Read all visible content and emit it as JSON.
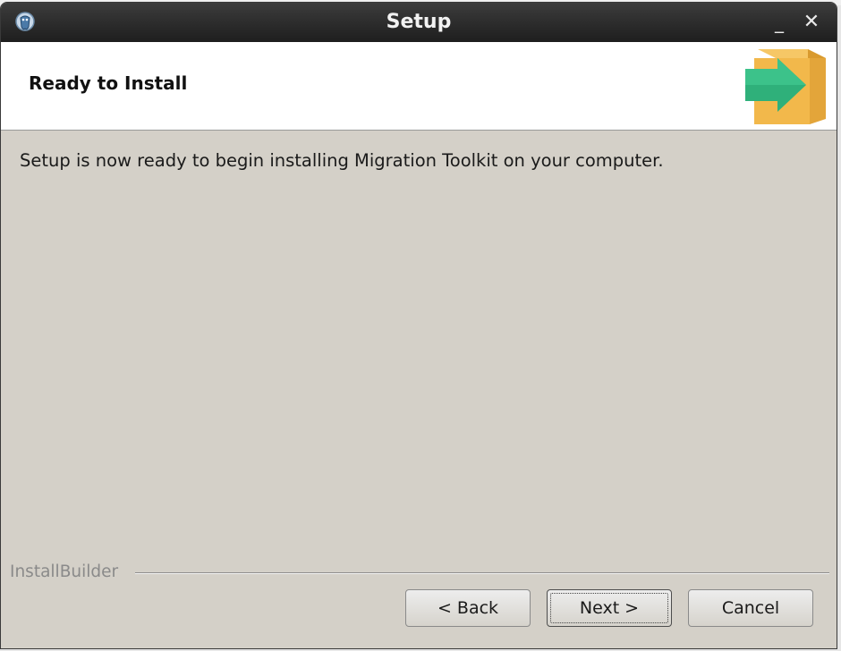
{
  "window": {
    "title": "Setup",
    "minimize_glyph": "_",
    "close_glyph": "✕"
  },
  "header": {
    "title": "Ready to Install",
    "icon": "package-arrow-icon"
  },
  "content": {
    "message": "Setup is now ready to begin installing Migration Toolkit on your computer."
  },
  "footer": {
    "brand": "InstallBuilder",
    "buttons": {
      "back": "< Back",
      "next": "Next >",
      "cancel": "Cancel"
    }
  },
  "colors": {
    "titlebar": "#2a2a2a",
    "dialog_bg": "#d4d0c8",
    "header_bg": "#ffffff",
    "arrow": "#2fb07a",
    "box": "#f2b84b"
  }
}
